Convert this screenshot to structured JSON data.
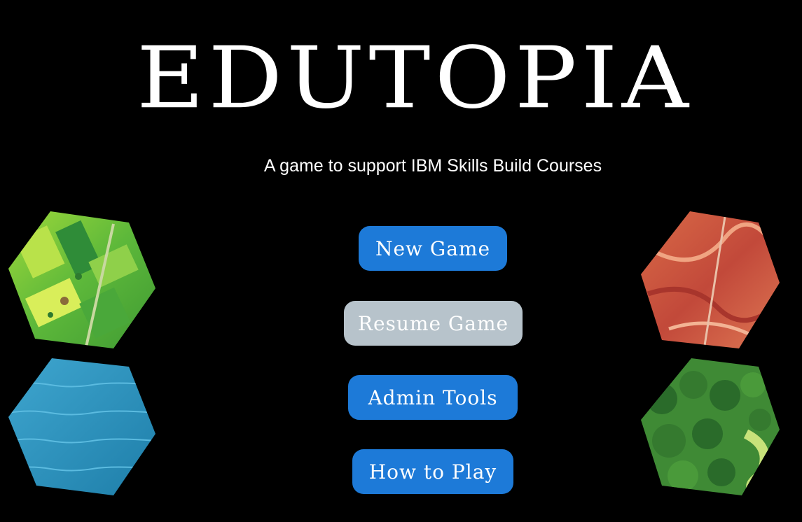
{
  "title": "EDUTOPIA",
  "subtitle": "A game to support IBM Skills Build Courses",
  "menu": {
    "new_game": "New Game",
    "resume_game": "Resume Game",
    "admin_tools": "Admin Tools",
    "how_to_play": "How to Play"
  },
  "colors": {
    "button_primary": "#1d7ad8",
    "button_disabled": "#b7c3cb",
    "background": "#000000"
  },
  "tiles": [
    "farmland-hex-tile",
    "water-hex-tile",
    "canyon-hex-tile",
    "forest-hex-tile"
  ]
}
